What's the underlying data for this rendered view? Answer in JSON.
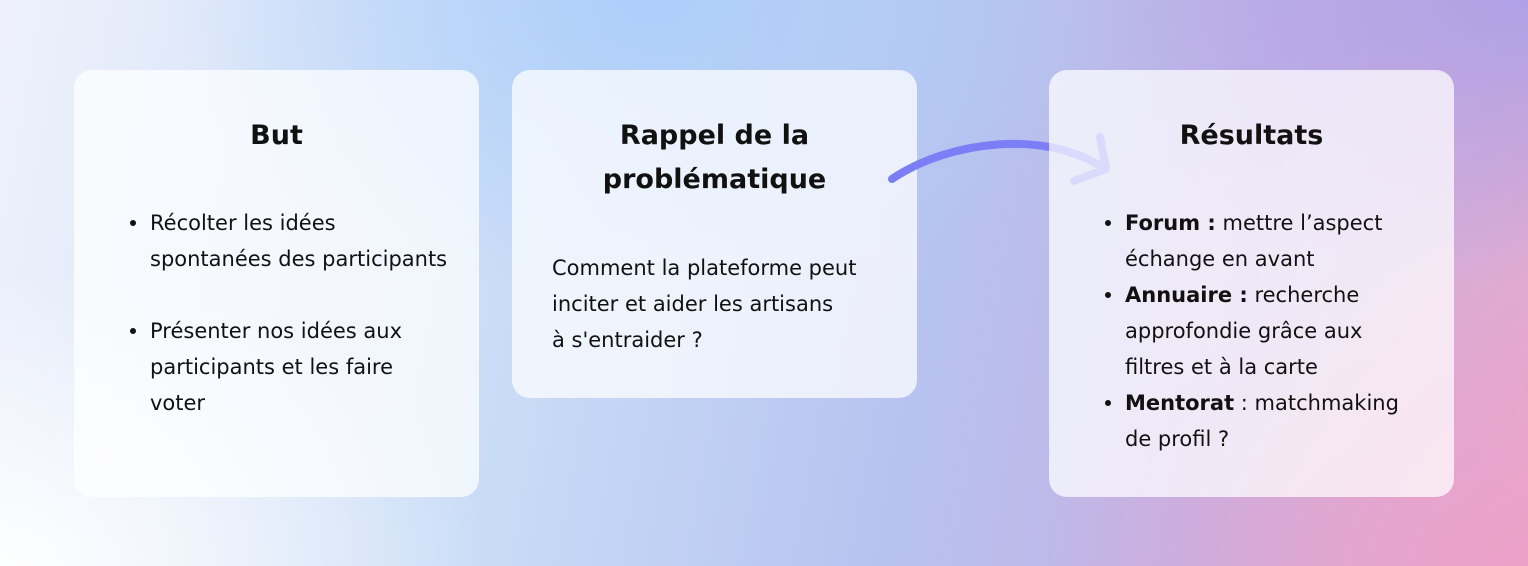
{
  "cards": {
    "but": {
      "title": "But",
      "items": [
        "Récolter les idées spontanées des participants",
        "Présenter nos idées aux participants et les faire voter"
      ]
    },
    "rappel": {
      "title_line1": "Rappel de la",
      "title_line2": "problématique",
      "text_lines": [
        "Comment la plateforme peut",
        "inciter et aider les artisans",
        "à s'entraider ?"
      ]
    },
    "resultats": {
      "title": "Résultats",
      "items": [
        {
          "bold": "Forum :",
          "text": " mettre l’aspect échange en avant"
        },
        {
          "bold": "Annuaire :",
          "text": " recherche approfondie grâce aux filtres et à la carte"
        },
        {
          "bold": "Mentorat",
          "text": " : matchmaking de profil ?"
        }
      ]
    }
  },
  "colors": {
    "arrow": "#7b7ef4",
    "text": "#111111",
    "card_background": "#ffffff"
  },
  "icons": {
    "connector": "curved-arrow-icon"
  }
}
